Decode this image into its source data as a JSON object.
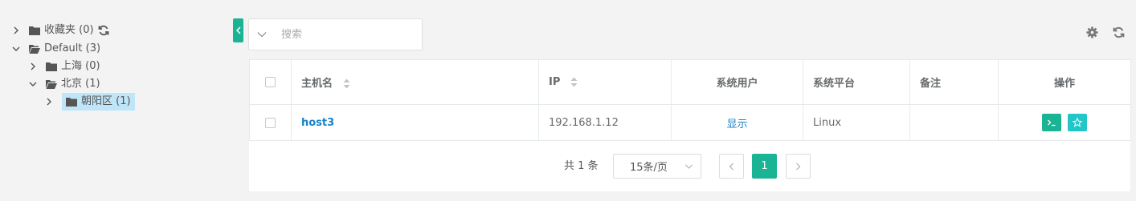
{
  "tree": {
    "nodes": [
      {
        "label": "收藏夹 (0)",
        "expanded": false,
        "refresh_icon": "refresh-icon"
      },
      {
        "label": "Default (3)",
        "expanded": true
      },
      {
        "label": "上海 (0)",
        "expanded": false
      },
      {
        "label": "北京 (1)",
        "expanded": true
      },
      {
        "label": "朝阳区 (1)",
        "expanded": false,
        "selected": true
      }
    ]
  },
  "search": {
    "placeholder": "搜索",
    "value": ""
  },
  "toolbar": {
    "settings_icon": "gear-icon",
    "refresh_icon": "refresh-icon"
  },
  "table": {
    "headers": [
      "主机名",
      "IP",
      "系统用户",
      "系统平台",
      "备注",
      "操作"
    ],
    "rows": [
      {
        "hostname": "host3",
        "ip": "192.168.1.12",
        "system_user": "显示",
        "platform": "Linux",
        "comment": "",
        "actions": [
          "terminal-icon",
          "star-icon"
        ]
      }
    ]
  },
  "pagination": {
    "total_text": "共 1 条",
    "page_size": "15条/页",
    "current_page": "1"
  },
  "colors": {
    "accent": "#1ab394",
    "accent_teal": "#23c6c8",
    "link": "#1c84c6",
    "selected_bg": "#bfe5f8"
  }
}
